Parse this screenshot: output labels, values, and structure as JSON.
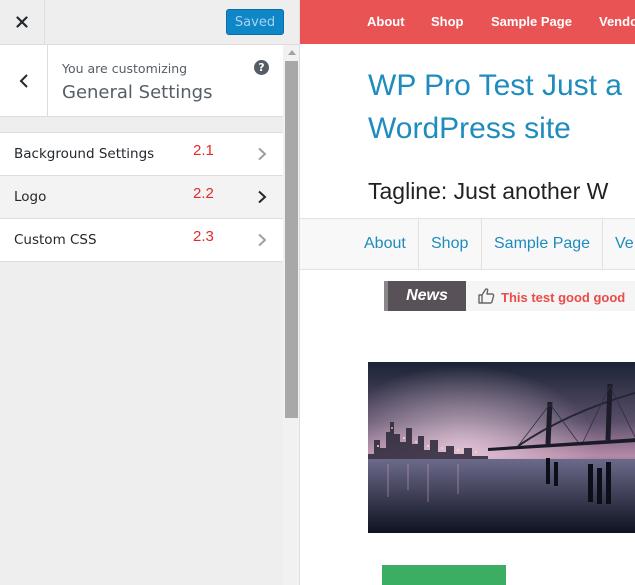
{
  "customizer": {
    "close_icon": "close-icon",
    "saved_label": "Saved",
    "customizing_label": "You are customizing",
    "panel_title": "General Settings",
    "back_icon": "chevron-left-icon",
    "help_icon": "question-mark-icon",
    "help_glyph": "?",
    "sections": [
      {
        "label": "Background Settings",
        "number": "2.1"
      },
      {
        "label": "Logo",
        "number": "2.2"
      },
      {
        "label": "Custom CSS",
        "number": "2.3"
      }
    ],
    "accent_color": "#0f86c7"
  },
  "preview": {
    "top_nav": [
      "About",
      "Shop",
      "Sample Page",
      "Vendo"
    ],
    "top_nav_color": "#ea5354",
    "site_title_line1": "WP Pro Test Just a",
    "site_title_line2": "WordPress site",
    "tagline": "Tagline: Just another W",
    "main_nav": [
      "About",
      "Shop",
      "Sample Page",
      "Ve"
    ],
    "news_label": "News",
    "news_icon": "thumbs-up-icon",
    "news_text": "This test good good",
    "link_color": "#1e8cbe"
  }
}
